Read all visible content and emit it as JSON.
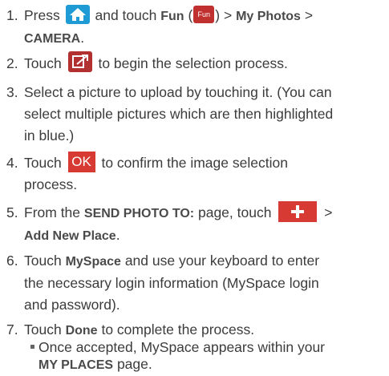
{
  "steps": [
    {
      "num": "1.",
      "t1": "Press",
      "t2": "and touch",
      "fun": "Fun",
      "t3": "(",
      "fun_icon": "Fun",
      "t4": ") >",
      "my_photos": "My Photos",
      "t5": ">",
      "camera": "CAMERA",
      "t6": "."
    },
    {
      "num": "2.",
      "t1": "Touch",
      "t2": "to begin the selection process."
    },
    {
      "num": "3.",
      "l1": "Select a picture to upload by touching it. (You can",
      "l2": "select multiple pictures which are then highlighted",
      "l3": "in blue.)"
    },
    {
      "num": "4.",
      "t1": "Touch",
      "ok": "OK",
      "t2": "to confirm the image selection",
      "l2": "process."
    },
    {
      "num": "5.",
      "t1": "From the",
      "send": "SEND PHOTO TO:",
      "t2": "page, touch",
      "t3": ">",
      "add": "Add New Place",
      "t4": "."
    },
    {
      "num": "6.",
      "t1": "Touch",
      "myspace": "MySpace",
      "t2": "and use your keyboard to enter",
      "l2": "the necessary login information (MySpace login",
      "l3": "and password)."
    },
    {
      "num": "7.",
      "t1": "Touch",
      "done": "Done",
      "t2": "to complete the process."
    }
  ],
  "bullet": {
    "l1": "Once accepted, MySpace appears within your",
    "my_places": "MY PLACES",
    "l2": "page."
  },
  "icons": [
    "home-icon",
    "fun-icon",
    "upload-icon",
    "ok-icon",
    "plus-icon"
  ],
  "colors": {
    "home": "#1e9bd4",
    "red": "#d63a32"
  }
}
